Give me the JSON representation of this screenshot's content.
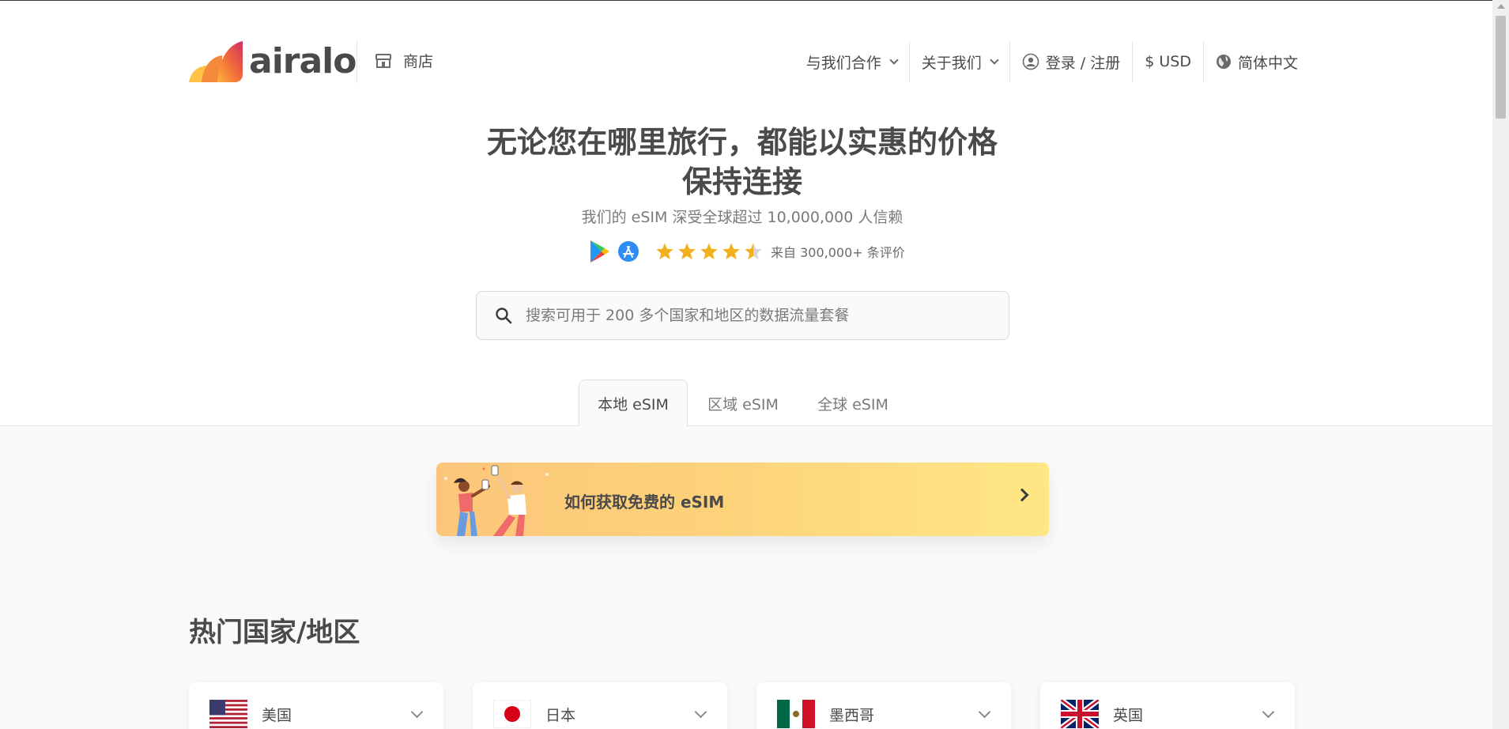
{
  "header": {
    "logo_text": "airalo",
    "shop_label": "商店",
    "nav": {
      "partner": "与我们合作",
      "about": "关于我们",
      "login": "登录 / 注册",
      "currency": "$ USD",
      "language": "简体中文"
    }
  },
  "hero": {
    "title_line1": "无论您在哪里旅行，都能以实惠的价格",
    "title_line2": "保持连接",
    "subtitle": "我们的 eSIM 深受全球超过 10,000,000 人信赖",
    "rating_stars": 4.5,
    "rating_text": "来自 300,000+ 条评价"
  },
  "search": {
    "placeholder": "搜索可用于 200 多个国家和地区的数据流量套餐"
  },
  "tabs": {
    "local": "本地 eSIM",
    "regional": "区域 eSIM",
    "global": "全球 eSIM",
    "active": "local"
  },
  "banner": {
    "text": "如何获取免费的 eSIM"
  },
  "popular": {
    "title": "热门国家/地区",
    "countries": [
      {
        "name": "美国"
      },
      {
        "name": "日本"
      },
      {
        "name": "墨西哥"
      },
      {
        "name": "英国"
      }
    ]
  },
  "colors": {
    "brand_gradient_start": "#fcc67a",
    "brand_gradient_end": "#ffe785",
    "star": "#f2b01e",
    "text_primary": "#4a4a4a"
  }
}
